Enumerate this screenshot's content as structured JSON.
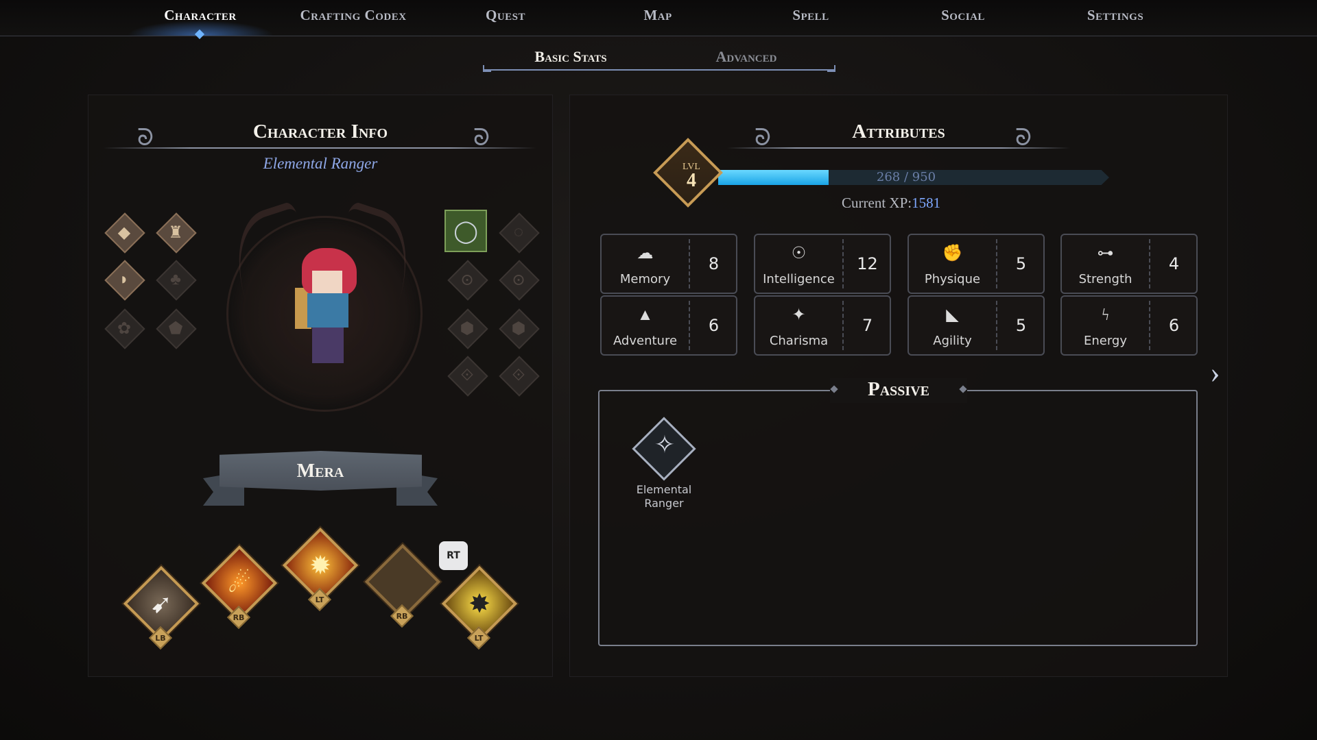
{
  "nav": {
    "tabs": [
      {
        "label": "Character",
        "active": true
      },
      {
        "label": "Crafting Codex",
        "active": false
      },
      {
        "label": "Quest",
        "active": false
      },
      {
        "label": "Map",
        "active": false
      },
      {
        "label": "Spell",
        "active": false
      },
      {
        "label": "Social",
        "active": false
      },
      {
        "label": "Settings",
        "active": false
      }
    ]
  },
  "subtabs": [
    {
      "label": "Basic Stats",
      "active": true
    },
    {
      "label": "Advanced",
      "active": false
    }
  ],
  "character_info": {
    "title": "Character Info",
    "class_name": "Elemental Ranger",
    "character_name": "Mera",
    "equipment_left": [
      {
        "icon": "gem-icon",
        "filled": true
      },
      {
        "icon": "armor-icon",
        "filled": true
      },
      {
        "icon": "boots-icon",
        "filled": true
      },
      {
        "icon": "clover-icon",
        "filled": false
      },
      {
        "icon": "paw-icon",
        "filled": false
      },
      {
        "icon": "shield-icon",
        "filled": false
      }
    ],
    "equipment_right": [
      {
        "icon": "ring-icon",
        "filled": true
      },
      {
        "icon": "ring-slot-icon",
        "filled": false
      },
      {
        "icon": "amulet-icon",
        "filled": false
      },
      {
        "icon": "amulet-icon",
        "filled": false
      },
      {
        "icon": "charm-icon",
        "filled": false
      },
      {
        "icon": "charm-icon",
        "filled": false
      },
      {
        "icon": "trinket-icon",
        "filled": false
      },
      {
        "icon": "trinket-icon",
        "filled": false
      }
    ],
    "skills": [
      {
        "icon": "arrow-skill-icon",
        "key": "LB"
      },
      {
        "icon": "fireball-skill-icon",
        "key": "RB"
      },
      {
        "icon": "explosion-skill-icon",
        "key": "LT"
      },
      {
        "icon": "empty-skill-slot-icon",
        "key": "RB"
      },
      {
        "icon": "burst-skill-icon",
        "key": "LT"
      }
    ],
    "swap_key": "RT"
  },
  "attributes": {
    "title": "Attributes",
    "level_label": "LVL",
    "level": "4",
    "xp_current": 268,
    "xp_max": 950,
    "xp_text": "268 / 950",
    "current_xp_label": "Current XP:",
    "current_xp_value": "1581",
    "stats": [
      {
        "name": "Memory",
        "value": "8",
        "icon": "brain-icon"
      },
      {
        "name": "Intelligence",
        "value": "12",
        "icon": "head-bulb-icon"
      },
      {
        "name": "Physique",
        "value": "5",
        "icon": "arm-flex-icon"
      },
      {
        "name": "Strength",
        "value": "4",
        "icon": "dumbbell-icon"
      },
      {
        "name": "Adventure",
        "value": "6",
        "icon": "mountain-icon"
      },
      {
        "name": "Charisma",
        "value": "7",
        "icon": "sparkle-icon"
      },
      {
        "name": "Agility",
        "value": "5",
        "icon": "shoe-icon"
      },
      {
        "name": "Energy",
        "value": "6",
        "icon": "lightning-icon"
      }
    ]
  },
  "passive": {
    "title": "Passive",
    "items": [
      {
        "name_line1": "Elemental",
        "name_line2": "Ranger",
        "icon": "elemental-ranger-emblem-icon"
      }
    ]
  },
  "colors": {
    "accent_blue": "#6fb4ff",
    "xp_bar": "#1aa4e6",
    "gold": "#c59a53",
    "class_text": "#8fa8e8"
  }
}
